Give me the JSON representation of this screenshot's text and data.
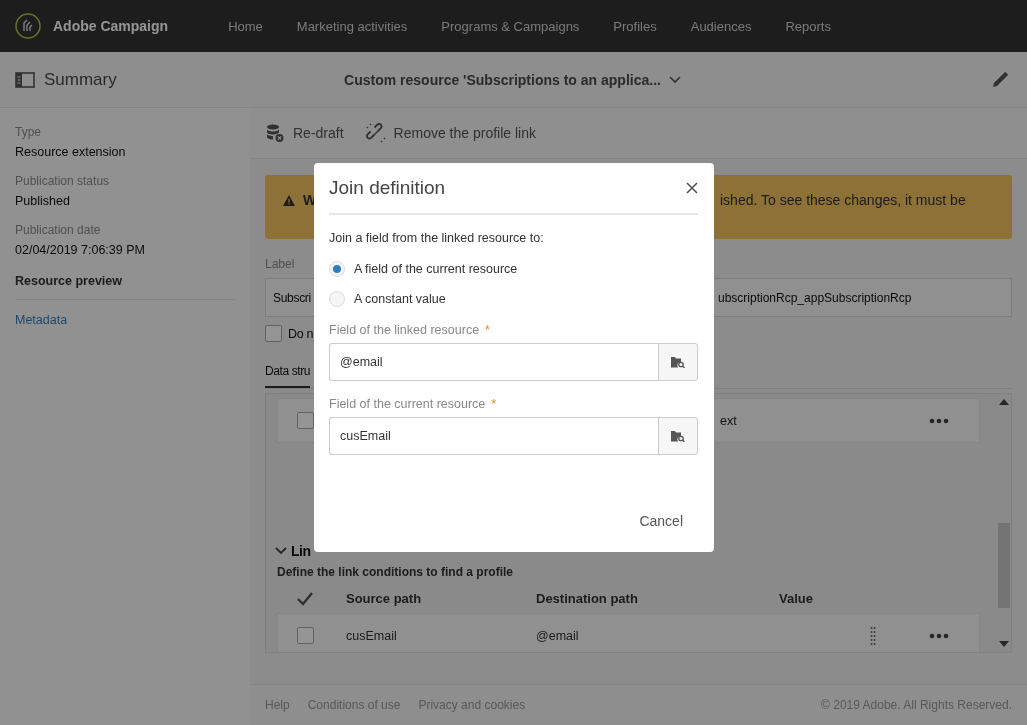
{
  "app": {
    "name": "Adobe Campaign"
  },
  "nav": [
    "Home",
    "Marketing activities",
    "Programs & Campaigns",
    "Profiles",
    "Audiences",
    "Reports"
  ],
  "header": {
    "title": "Summary",
    "resource_title": "Custom resource 'Subscriptions to an applica..."
  },
  "sidebar": {
    "fields": [
      {
        "label": "Type",
        "value": "Resource extension"
      },
      {
        "label": "Publication status",
        "value": "Published"
      },
      {
        "label": "Publication date",
        "value": "02/04/2019 7:06:39 PM"
      }
    ],
    "items": [
      {
        "label": "Resource preview",
        "kind": "heading"
      },
      {
        "label": "Metadata",
        "kind": "link"
      }
    ]
  },
  "toolbar": [
    "Re-draft",
    "Remove the profile link"
  ],
  "warning": {
    "lead": "W",
    "text": "ished. To see these changes, it must be"
  },
  "label_field": {
    "label": "Label",
    "value_start": "Subscri",
    "value_end": "ubscriptionRcp_appSubscriptionRcp"
  },
  "checkbox": {
    "label": "Do n",
    "checked": false
  },
  "tabs": [
    {
      "label": "Data stru",
      "selected": true
    }
  ],
  "data_rows": [
    {
      "checked": false,
      "column_2": "ext"
    }
  ],
  "link_section": {
    "title": "Lin",
    "expanded": true,
    "description": "Define the link conditions to find a profile",
    "columns": [
      "Source path",
      "Destination path",
      "Value"
    ],
    "rows": [
      {
        "checked": false,
        "source": "cusEmail",
        "destination": "@email"
      }
    ]
  },
  "dialog": {
    "title": "Join definition",
    "prompt": "Join a field from the linked resource to:",
    "options": [
      {
        "label": "A field of the current resource",
        "selected": true
      },
      {
        "label": "A constant value",
        "selected": false
      }
    ],
    "fields": [
      {
        "label": "Field of the linked resource",
        "required_mark": "*",
        "value": "@email"
      },
      {
        "label": "Field of the current resource",
        "required_mark": "*",
        "value": "cusEmail"
      }
    ],
    "buttons": [
      "Cancel"
    ]
  },
  "footer": {
    "links": [
      "Help",
      "Conditions of use",
      "Privacy and cookies"
    ],
    "copyright": "© 2019 Adobe. All Rights Reserved."
  }
}
